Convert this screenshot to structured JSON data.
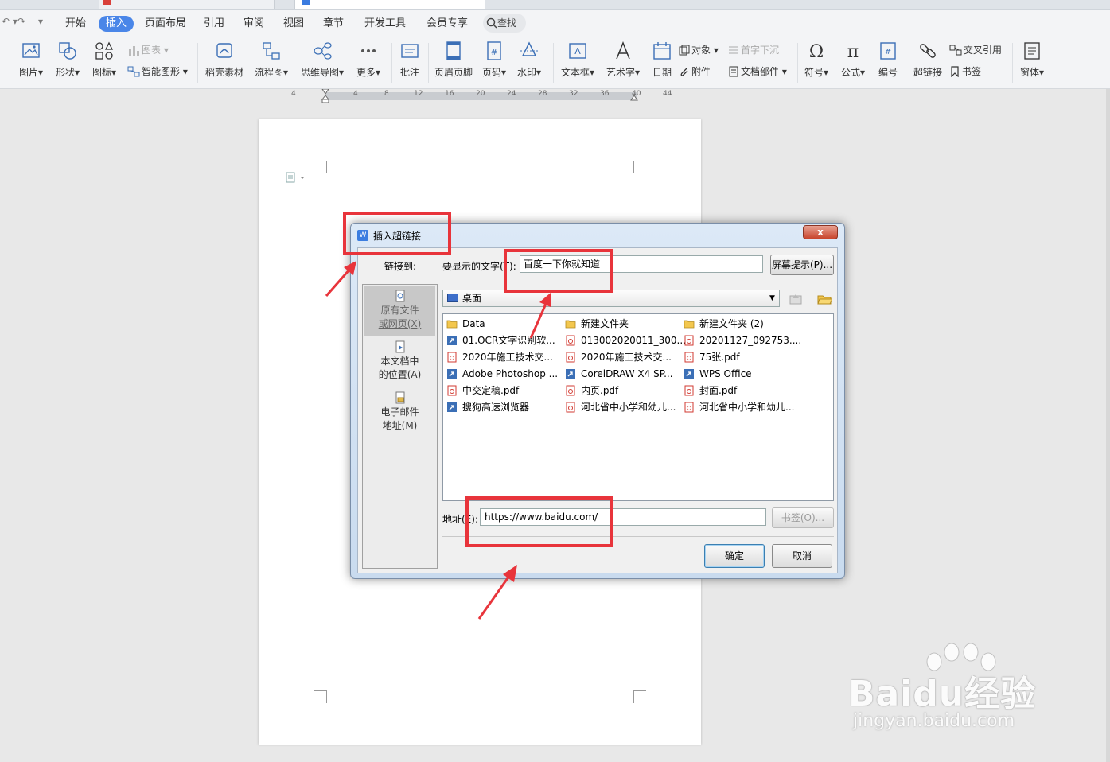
{
  "menu": {
    "items": [
      "开始",
      "插入",
      "页面布局",
      "引用",
      "审阅",
      "视图",
      "章节",
      "开发工具",
      "会员专享"
    ],
    "active": "插入",
    "search": "查找"
  },
  "ribbon": {
    "picture": "图片",
    "shape": "形状",
    "icon": "图标",
    "chart": "图表",
    "smart_graphic": "智能图形",
    "docer": "稻壳素材",
    "flowchart": "流程图",
    "mindmap": "思维导图",
    "more": "更多",
    "comment": "批注",
    "header_footer": "页眉页脚",
    "page_number": "页码",
    "watermark": "水印",
    "textbox": "文本框",
    "wordart": "艺术字",
    "date": "日期",
    "object": "对象",
    "attachment": "附件",
    "dropcap": "首字下沉",
    "doc_parts": "文档部件",
    "symbol": "符号",
    "formula": "公式",
    "numbering": "编号",
    "hyperlink": "超链接",
    "cross_ref": "交叉引用",
    "bookmark": "书签",
    "window": "窗体"
  },
  "ruler": {
    "ticks": [
      "4",
      "4",
      "8",
      "12",
      "16",
      "20",
      "24",
      "28",
      "32",
      "36",
      "40",
      "44"
    ]
  },
  "dialog": {
    "title": "插入超链接",
    "close": "x",
    "link_to_label": "链接到:",
    "nav": [
      {
        "label_line1": "原有文件",
        "label_line2": "或网页(X)"
      },
      {
        "label_line1": "本文档中",
        "label_line2": "的位置(A)"
      },
      {
        "label_line1": "电子邮件",
        "label_line2": "地址(M)"
      }
    ],
    "display_text_label": "要显示的文字(T):",
    "display_text_value": "百度一下你就知道",
    "screen_tip_button": "屏幕提示(P)...",
    "folder": "桌面",
    "files": [
      {
        "name": "Data",
        "type": "folder"
      },
      {
        "name": "新建文件夹",
        "type": "folder"
      },
      {
        "name": "新建文件夹 (2)",
        "type": "folder"
      },
      {
        "name": "01.OCR文字识别软...",
        "type": "app"
      },
      {
        "name": "013002020011_300...",
        "type": "pdf"
      },
      {
        "name": "20201127_092753....",
        "type": "pdf"
      },
      {
        "name": "2020年施工技术交...",
        "type": "pdf"
      },
      {
        "name": "2020年施工技术交...",
        "type": "pdf"
      },
      {
        "name": "75张.pdf",
        "type": "pdf"
      },
      {
        "name": "Adobe Photoshop ...",
        "type": "app"
      },
      {
        "name": "CorelDRAW X4 SP...",
        "type": "app"
      },
      {
        "name": "WPS Office",
        "type": "app"
      },
      {
        "name": "中交定稿.pdf",
        "type": "pdf"
      },
      {
        "name": "内页.pdf",
        "type": "pdf"
      },
      {
        "name": "封面.pdf",
        "type": "pdf"
      },
      {
        "name": "搜狗高速浏览器",
        "type": "app"
      },
      {
        "name": "河北省中小学和幼儿...",
        "type": "pdf"
      },
      {
        "name": "河北省中小学和幼儿...",
        "type": "pdf"
      }
    ],
    "address_label": "地址(E):",
    "address_value": "https://www.baidu.com/",
    "bookmark_button": "书签(O)...",
    "ok_button": "确定",
    "cancel_button": "取消"
  },
  "watermark": {
    "brand": "Baidu经验",
    "url": "jingyan.baidu.com"
  },
  "colors": {
    "accent": "#4a86e8",
    "annotation": "#e8343b"
  }
}
